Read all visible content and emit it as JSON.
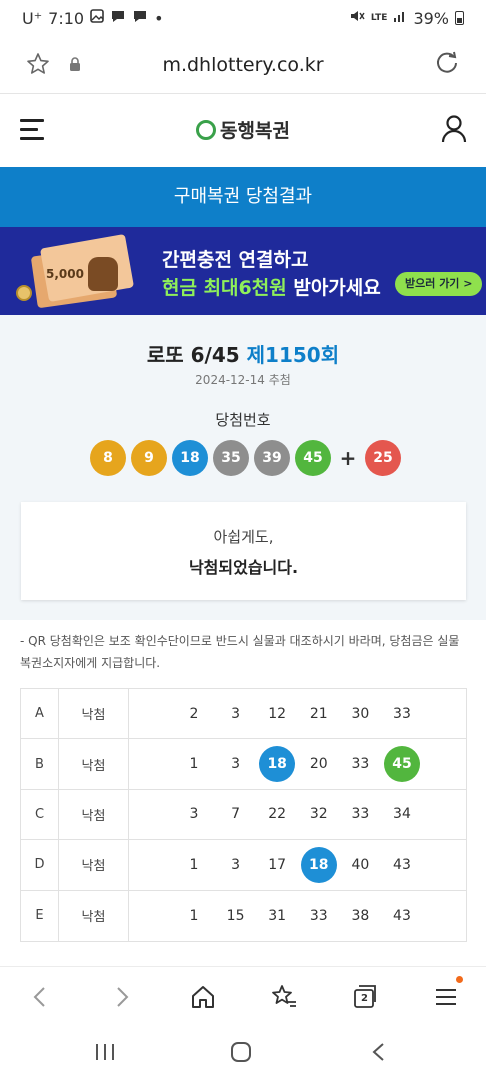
{
  "status_bar": {
    "carrier": "U⁺",
    "time": "7:10",
    "network": "LTE",
    "battery": "39%"
  },
  "browser": {
    "url": "m.dhlottery.co.kr"
  },
  "site": {
    "logo_text": "동행복권"
  },
  "page": {
    "title": "구매복권 당첨결과"
  },
  "banner": {
    "bill_text": "5,000",
    "line1": "간편충전 연결하고",
    "line2_highlight": "현금 최대6천원",
    "line2_rest": " 받아가세요",
    "cta": "받으러 가기 >"
  },
  "result": {
    "game_name": "로또 6/45",
    "round": "제1150회",
    "draw_date": "2024-12-14 추첨",
    "winning_label": "당첨번호",
    "winning_numbers": [
      {
        "value": "8",
        "color": "#e6a51d"
      },
      {
        "value": "9",
        "color": "#e6a51d"
      },
      {
        "value": "18",
        "color": "#1e8fd6"
      },
      {
        "value": "35",
        "color": "#8e8e8e"
      },
      {
        "value": "39",
        "color": "#8e8e8e"
      },
      {
        "value": "45",
        "color": "#52b63e"
      }
    ],
    "plus": "+",
    "bonus_number": {
      "value": "25",
      "color": "#e4574e"
    },
    "message_line1": "아쉽게도,",
    "message_line2": "낙첨되었습니다."
  },
  "notice": "- QR 당첨확인은 보조 확인수단이므로 반드시 실물과 대조하시기 바라며, 당첨금은 실물 복권소지자에게 지급합니다.",
  "tickets": [
    {
      "game": "A",
      "result": "낙첨",
      "numbers": [
        {
          "n": "2"
        },
        {
          "n": "3"
        },
        {
          "n": "12"
        },
        {
          "n": "21"
        },
        {
          "n": "30"
        },
        {
          "n": "33"
        }
      ]
    },
    {
      "game": "B",
      "result": "낙첨",
      "numbers": [
        {
          "n": "1"
        },
        {
          "n": "3"
        },
        {
          "n": "18",
          "hit": "#1e8fd6"
        },
        {
          "n": "20"
        },
        {
          "n": "33"
        },
        {
          "n": "45",
          "hit": "#52b63e"
        }
      ]
    },
    {
      "game": "C",
      "result": "낙첨",
      "numbers": [
        {
          "n": "3"
        },
        {
          "n": "7"
        },
        {
          "n": "22"
        },
        {
          "n": "32"
        },
        {
          "n": "33"
        },
        {
          "n": "34"
        }
      ]
    },
    {
      "game": "D",
      "result": "낙첨",
      "numbers": [
        {
          "n": "1"
        },
        {
          "n": "3"
        },
        {
          "n": "17"
        },
        {
          "n": "18",
          "hit": "#1e8fd6"
        },
        {
          "n": "40"
        },
        {
          "n": "43"
        }
      ]
    },
    {
      "game": "E",
      "result": "낙첨",
      "numbers": [
        {
          "n": "1"
        },
        {
          "n": "15"
        },
        {
          "n": "31"
        },
        {
          "n": "33"
        },
        {
          "n": "38"
        },
        {
          "n": "43"
        }
      ]
    }
  ],
  "toolbar": {
    "tab_count": "2"
  },
  "icons": {
    "status": [
      "gallery-icon",
      "chat-icon",
      "chat-icon",
      "mute-icon",
      "signal-icon",
      "battery-icon"
    ],
    "url_bar": [
      "star-icon",
      "lock-icon",
      "reload-icon"
    ],
    "header": [
      "menu-icon",
      "user-icon"
    ],
    "toolbar": [
      "back-icon",
      "forward-icon",
      "home-icon",
      "bookmarks-icon",
      "tabs-icon",
      "menu-icon"
    ],
    "system_nav": [
      "recent-apps-icon",
      "home-button-icon",
      "back-icon"
    ]
  }
}
